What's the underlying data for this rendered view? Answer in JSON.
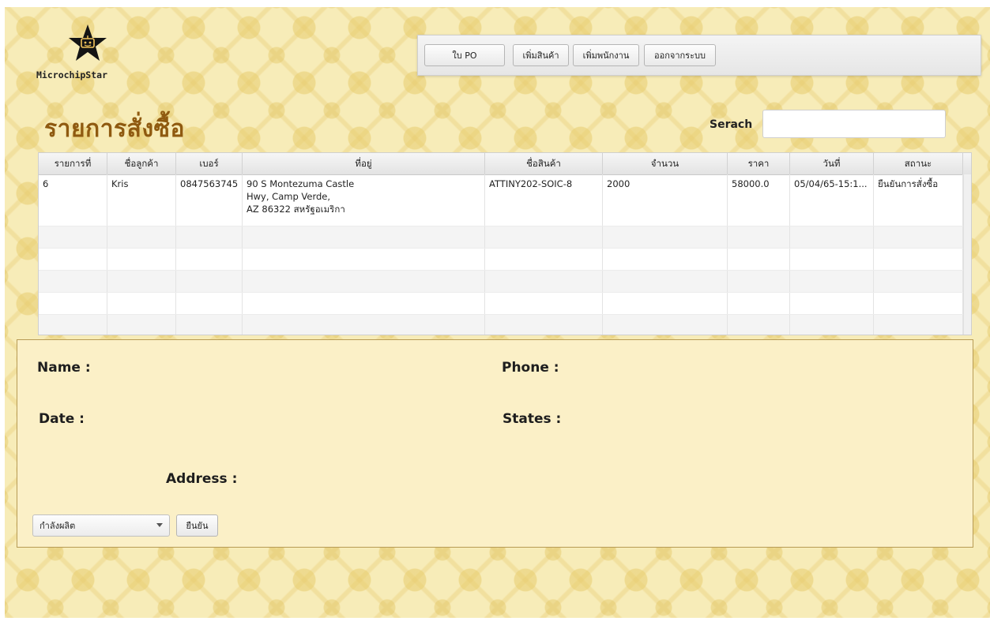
{
  "brand": {
    "name": "MicrochipStar"
  },
  "toolbar": {
    "buttons": [
      "ใบ PO",
      "เพิ่มสินค้า",
      "เพิ่มพนักงาน",
      "ออกจากระบบ"
    ]
  },
  "page": {
    "title": "รายการสั่งซื้อ"
  },
  "search": {
    "label": "Serach",
    "value": ""
  },
  "table": {
    "columns": [
      "รายการที่",
      "ชื่อลูกค้า",
      "เบอร์",
      "ที่อยู่",
      "ชื่อสินค้า",
      "จำนวน",
      "ราคา",
      "วันที่",
      "สถานะ"
    ],
    "rows": [
      {
        "id": "6",
        "customer": "Kris",
        "phone": "0847563745",
        "address": [
          "90 S Montezuma Castle",
          "Hwy, Camp Verde,",
          "AZ 86322 สหรัฐอเมริกา"
        ],
        "product": "ATTINY202-SOIC-8",
        "quantity": "2000",
        "price": "58000.0",
        "date": "05/04/65-15:1...",
        "status": "ยืนยันการสั่งซื้อ"
      }
    ]
  },
  "detail": {
    "name_label": "Name :",
    "phone_label": "Phone :",
    "date_label": "Date :",
    "states_label": "States :",
    "address_label": "Address :",
    "status_select_value": "กำลังผลิต",
    "confirm_label": "ยืนยัน"
  },
  "icons": {
    "logo": "robot-star-icon",
    "dropdown": "chevron-down-icon"
  },
  "colors": {
    "title": "#8f5a10",
    "panel_bg": "#fbf0c7",
    "panel_border": "#b79b55"
  }
}
